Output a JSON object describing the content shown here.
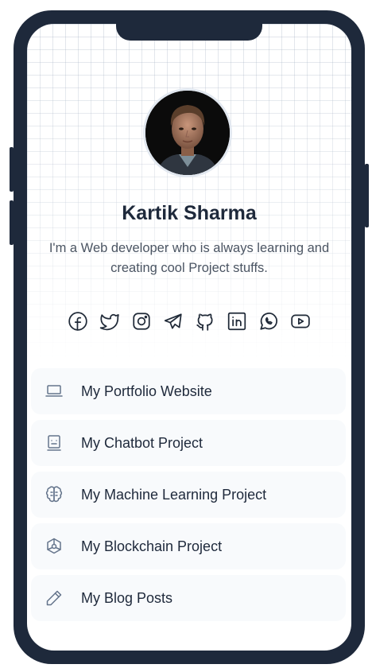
{
  "profile": {
    "name": "Kartik Sharma",
    "bio": "I'm a Web developer who is always learning and creating cool Project stuffs."
  },
  "socials": [
    {
      "icon": "facebook-icon"
    },
    {
      "icon": "twitter-icon"
    },
    {
      "icon": "instagram-icon"
    },
    {
      "icon": "telegram-icon"
    },
    {
      "icon": "github-icon"
    },
    {
      "icon": "linkedin-icon"
    },
    {
      "icon": "whatsapp-icon"
    },
    {
      "icon": "youtube-icon"
    }
  ],
  "links": [
    {
      "label": "My Portfolio Website",
      "icon": "laptop-icon"
    },
    {
      "label": "My Chatbot Project",
      "icon": "robot-icon"
    },
    {
      "label": "My Machine Learning Project",
      "icon": "brain-icon"
    },
    {
      "label": "My Blockchain Project",
      "icon": "blockchain-icon"
    },
    {
      "label": "My Blog Posts",
      "icon": "pencil-icon"
    }
  ],
  "colors": {
    "frame": "#1e293b",
    "link_bg": "#f8fafc",
    "text_primary": "#1e293b",
    "text_secondary": "#4b5563",
    "icon_muted": "#64748b"
  }
}
